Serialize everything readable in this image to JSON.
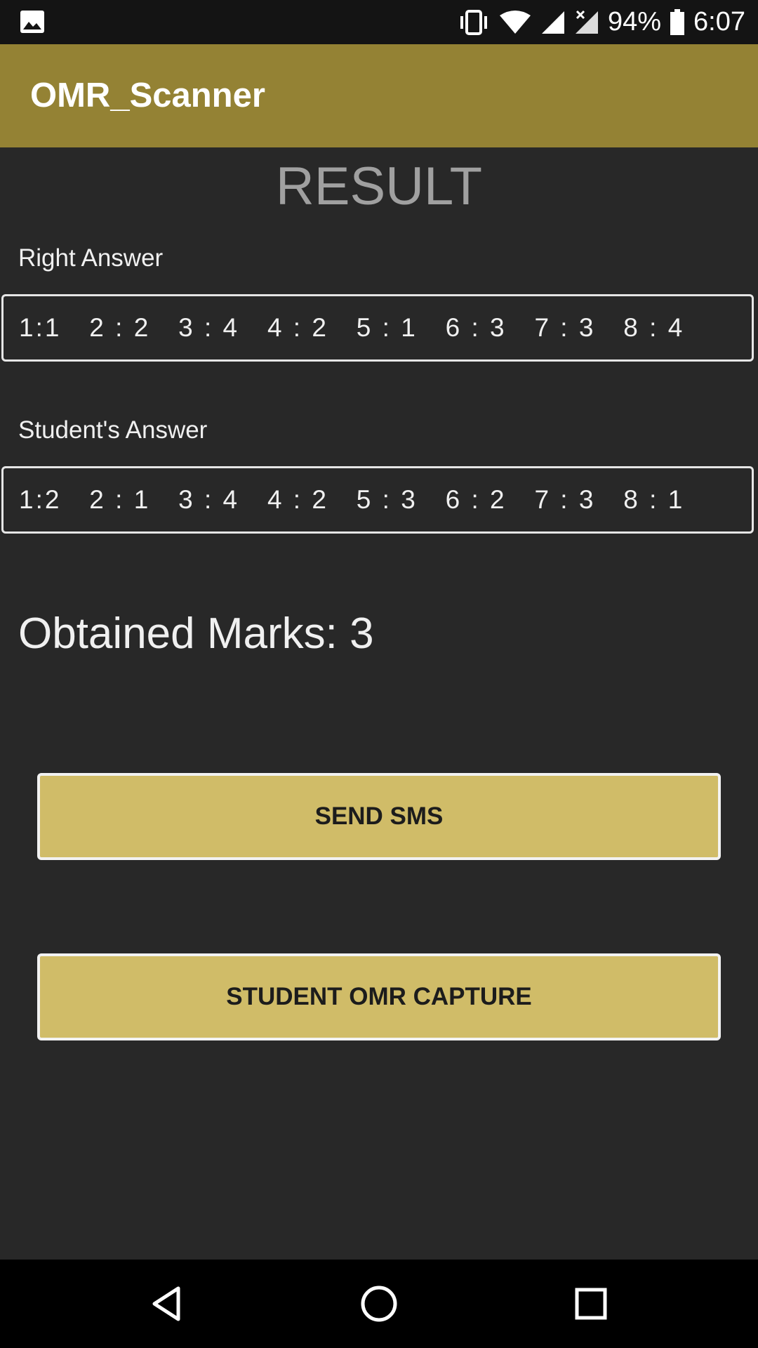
{
  "status_bar": {
    "battery": "94%",
    "time": "6:07",
    "icons": [
      "gallery-icon",
      "vibrate-icon",
      "wifi-icon",
      "signal-icon",
      "signal-no-data-icon",
      "battery-icon"
    ]
  },
  "app_bar": {
    "title": "OMR_Scanner"
  },
  "main": {
    "heading": "RESULT",
    "right_answer_label": "Right Answer",
    "right_answer_value": "1:1   2 : 2   3 : 4   4 : 2   5 : 1   6 : 3   7 : 3   8 : 4",
    "student_answer_label": "Student's Answer",
    "student_answer_value": "1:2   2 : 1   3 : 4   4 : 2   5 : 3   6 : 2   7 : 3   8 : 1",
    "obtained_marks": "Obtained Marks: 3"
  },
  "buttons": {
    "send_sms": "SEND SMS",
    "capture": "STUDENT OMR CAPTURE"
  },
  "nav_bar": {
    "icons": [
      "back-icon",
      "home-icon",
      "recents-icon"
    ]
  },
  "colors": {
    "app_bar": "#948234",
    "button": "#d0bc68",
    "background": "#282828"
  }
}
